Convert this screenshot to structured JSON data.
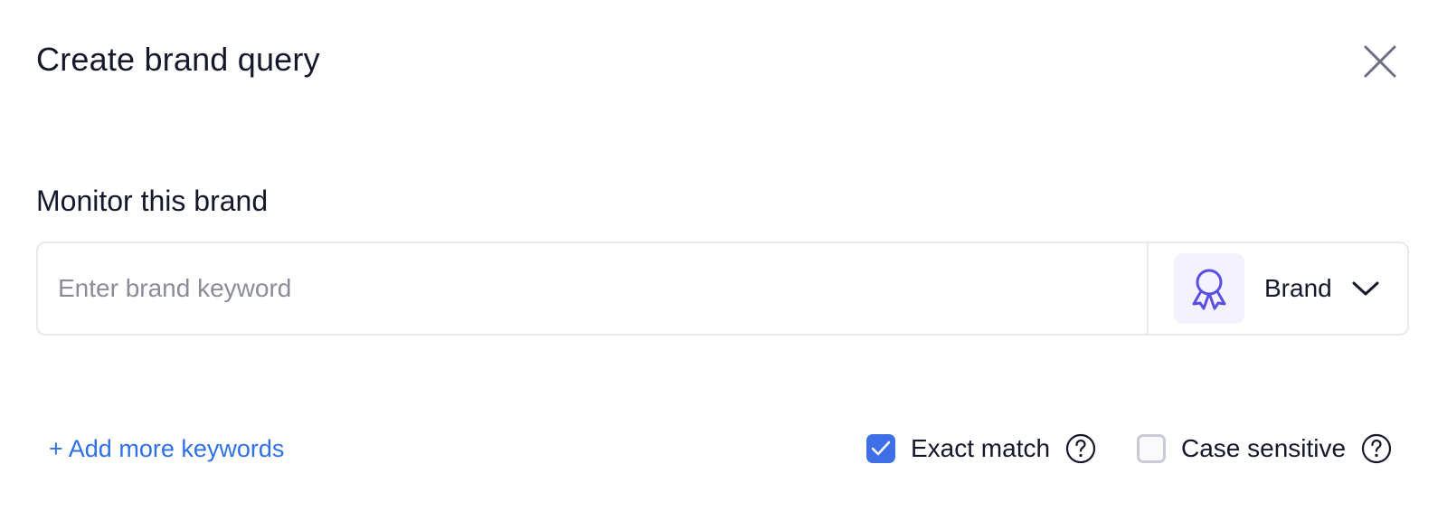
{
  "dialog": {
    "title": "Create brand query",
    "close_icon": "close-icon"
  },
  "form": {
    "section_label": "Monitor this brand",
    "keyword": {
      "value": "",
      "placeholder": "Enter brand keyword"
    },
    "type_select": {
      "selected": "Brand",
      "icon": "award-ribbon-icon",
      "dropdown_icon": "chevron-down-icon"
    },
    "add_more_label": "+ Add more keywords",
    "options": {
      "exact_match": {
        "label": "Exact match",
        "checked": true,
        "help_icon": "help-icon"
      },
      "case_sensitive": {
        "label": "Case sensitive",
        "checked": false,
        "help_icon": "help-icon"
      }
    }
  },
  "colors": {
    "accent": "#3f6fe6",
    "link": "#2f6fe8",
    "icon_purple": "#5b4fe3",
    "icon_bg": "#f3f2fd",
    "border": "#e8e9ef"
  }
}
